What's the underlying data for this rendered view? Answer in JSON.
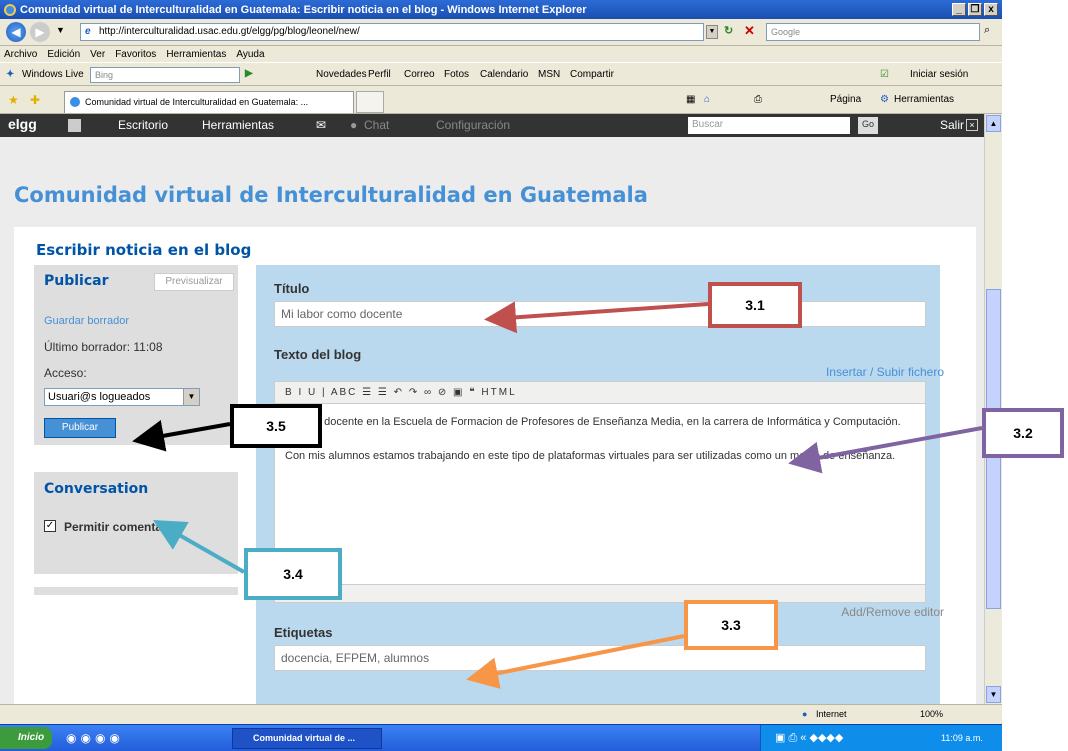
{
  "window": {
    "title": "Comunidad virtual de Interculturalidad en Guatemala: Escribir noticia en el blog - Windows Internet Explorer",
    "controls": [
      "_",
      "❐",
      "x"
    ]
  },
  "address_bar": {
    "url": "http://interculturalidad.usac.edu.gt/elgg/pg/blog/leonel/new/",
    "search_placeholder": "Google"
  },
  "menu": [
    "Archivo",
    "Edición",
    "Ver",
    "Favoritos",
    "Herramientas",
    "Ayuda"
  ],
  "live_bar": {
    "brand": "Windows Live",
    "search_placeholder": "Bing",
    "links": [
      "Novedades",
      "Perfil",
      "Correo",
      "Fotos",
      "Calendario",
      "MSN",
      "Compartir"
    ],
    "signin": "Iniciar sesión"
  },
  "tab_bar": {
    "tab_title": "Comunidad virtual de Interculturalidad en Guatemala: ...",
    "page_menu": "Página",
    "tools_menu": "Herramientas"
  },
  "elgg_bar": {
    "logo": "elgg",
    "items": [
      "Escritorio",
      "Herramientas",
      "Chat",
      "Configuración"
    ],
    "search_placeholder": "Buscar",
    "go": "Go",
    "logout": "Salir"
  },
  "site_title": "Comunidad virtual de Interculturalidad en Guatemala",
  "page_title": "Escribir noticia en el blog",
  "publish": {
    "heading": "Publicar",
    "preview": "Previsualizar",
    "save_draft": "Guardar borrador",
    "last_draft": "Último borrador: 11:08",
    "access_label": "Acceso:",
    "access_value": "Usuari@s logueados",
    "publish_button": "Publicar"
  },
  "conversation": {
    "heading": "Conversation",
    "allow_comments": "Permitir comentarios"
  },
  "form": {
    "title_label": "Título",
    "title_value": "Mi labor como docente",
    "body_label": "Texto del blog",
    "insert_link": "Insertar / Subir fichero",
    "toolbar": "B  I  U  | ABC  ☰  ☰  ↶  ↷  ∞  ⊘  ▣  ❝  HTML",
    "body_p1": "o como docente en la Escuela de Formacion de Profesores de Enseñanza Media, en la carrera de Informática y Computación.",
    "body_p2": "Con mis alumnos estamos trabajando en este tipo de plataformas virtuales para ser utilizadas como un medio de enseñanza.",
    "add_remove_editor": "Add/Remove editor",
    "tags_label": "Etiquetas",
    "tags_value": "docencia, EFPEM, alumnos"
  },
  "callouts": [
    {
      "label": "3.1",
      "color": "#c0504d"
    },
    {
      "label": "3.2",
      "color": "#8064a2"
    },
    {
      "label": "3.3",
      "color": "#f79646"
    },
    {
      "label": "3.4",
      "color": "#4bacc6"
    },
    {
      "label": "3.5",
      "color": "#000000"
    }
  ],
  "status_bar": {
    "zone": "Internet",
    "zoom": "100%"
  },
  "taskbar": {
    "start": "Inicio",
    "task": "Comunidad virtual de ...",
    "clock": "11:09 a.m."
  }
}
